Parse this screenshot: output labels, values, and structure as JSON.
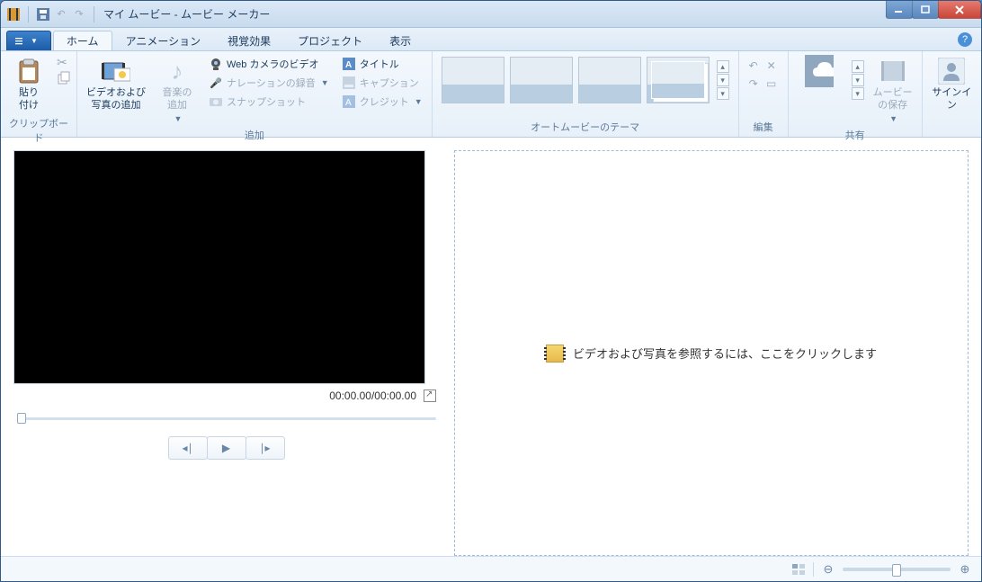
{
  "titlebar": {
    "title": "マイ ムービー - ムービー メーカー"
  },
  "tabs": {
    "home": "ホーム",
    "animation": "アニメーション",
    "visual": "視覚効果",
    "project": "プロジェクト",
    "view": "表示"
  },
  "ribbon": {
    "clipboard": {
      "label": "クリップボード",
      "paste": "貼り\n付け"
    },
    "add": {
      "label": "追加",
      "add_media": "ビデオおよび\n写真の追加",
      "add_music": "音楽の\n追加",
      "webcam": "Web カメラのビデオ",
      "narration": "ナレーションの録音",
      "snapshot": "スナップショット",
      "title": "タイトル",
      "caption": "キャプション",
      "credit": "クレジット"
    },
    "themes": {
      "label": "オートムービーのテーマ"
    },
    "edit": {
      "label": "編集"
    },
    "share": {
      "label": "共有",
      "save_movie": "ムービー\nの保存"
    },
    "signin": {
      "label": "サインイン"
    }
  },
  "preview": {
    "time": "00:00.00/00:00.00"
  },
  "storyboard": {
    "prompt": "ビデオおよび写真を参照するには、ここをクリックします"
  }
}
